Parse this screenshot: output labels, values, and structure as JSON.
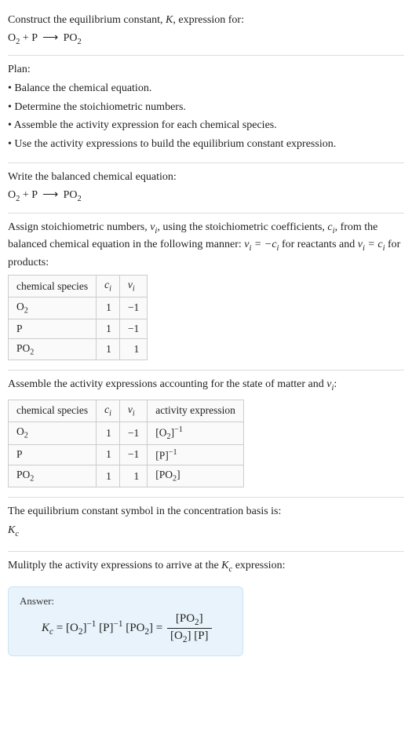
{
  "prompt": {
    "line1_a": "Construct the equilibrium constant, ",
    "line1_b": ", expression for:",
    "reaction_lhs_o2": "O",
    "reaction_plus": " + ",
    "reaction_lhs_p": "P",
    "reaction_arrow": "⟶",
    "reaction_rhs_po2": "PO"
  },
  "plan": {
    "heading": "Plan:",
    "b1": "• Balance the chemical equation.",
    "b2": "• Determine the stoichiometric numbers.",
    "b3": "• Assemble the activity expression for each chemical species.",
    "b4": "• Use the activity expressions to build the equilibrium constant expression."
  },
  "balanced": {
    "intro": "Write the balanced chemical equation:"
  },
  "assign": {
    "p_a": "Assign stoichiometric numbers, ",
    "p_b": ", using the stoichiometric coefficients, ",
    "p_c": ", from the balanced chemical equation in the following manner: ",
    "p_d": " for reactants and ",
    "p_e": " for products:",
    "nu": "ν",
    "ci": "c",
    "eq1_a": "ν",
    "eq1_b": " = −c",
    "eq2_a": "ν",
    "eq2_b": " = c",
    "sub_i": "i"
  },
  "table1": {
    "h1": "chemical species",
    "h2": "c",
    "h3": "ν",
    "rows": [
      {
        "sp_a": "O",
        "sp_sub": "2",
        "sp_b": "",
        "c": "1",
        "v": "−1"
      },
      {
        "sp_a": "P",
        "sp_sub": "",
        "sp_b": "",
        "c": "1",
        "v": "−1"
      },
      {
        "sp_a": "PO",
        "sp_sub": "2",
        "sp_b": "",
        "c": "1",
        "v": "1"
      }
    ]
  },
  "assemble": {
    "intro_a": "Assemble the activity expressions accounting for the state of matter and ",
    "intro_b": ":"
  },
  "table2": {
    "h1": "chemical species",
    "h2": "c",
    "h3": "ν",
    "h4": "activity expression",
    "rows": [
      {
        "sp_a": "O",
        "sp_sub": "2",
        "c": "1",
        "v": "−1",
        "ae_a": "[O",
        "ae_sub": "2",
        "ae_b": "]",
        "ae_sup": "−1"
      },
      {
        "sp_a": "P",
        "sp_sub": "",
        "c": "1",
        "v": "−1",
        "ae_a": "[P",
        "ae_sub": "",
        "ae_b": "]",
        "ae_sup": "−1"
      },
      {
        "sp_a": "PO",
        "sp_sub": "2",
        "c": "1",
        "v": "1",
        "ae_a": "[PO",
        "ae_sub": "2",
        "ae_b": "]",
        "ae_sup": ""
      }
    ]
  },
  "symbol": {
    "line": "The equilibrium constant symbol in the concentration basis is:",
    "K": "K",
    "sub_c": "c"
  },
  "multiply": {
    "line_a": "Mulitply the activity expressions to arrive at the ",
    "line_b": " expression:"
  },
  "answer": {
    "label": "Answer:",
    "K": "K",
    "sub_c": "c",
    "eq": " = ",
    "t1_a": "[O",
    "t1_sub": "2",
    "t1_b": "]",
    "t1_sup": "−1",
    "sp1": " ",
    "t2_a": "[P]",
    "t2_sup": "−1",
    "sp2": " ",
    "t3_a": "[PO",
    "t3_sub": "2",
    "t3_b": "]",
    "eq2": " = ",
    "frac_num_a": "[PO",
    "frac_num_sub": "2",
    "frac_num_b": "]",
    "frac_den_a": "[O",
    "frac_den_sub": "2",
    "frac_den_b": "] [P]"
  },
  "chart_data": {
    "type": "table",
    "tables": [
      {
        "title": "stoichiometric numbers",
        "columns": [
          "chemical species",
          "c_i",
          "ν_i"
        ],
        "rows": [
          [
            "O2",
            1,
            -1
          ],
          [
            "P",
            1,
            -1
          ],
          [
            "PO2",
            1,
            1
          ]
        ]
      },
      {
        "title": "activity expressions",
        "columns": [
          "chemical species",
          "c_i",
          "ν_i",
          "activity expression"
        ],
        "rows": [
          [
            "O2",
            1,
            -1,
            "[O2]^-1"
          ],
          [
            "P",
            1,
            -1,
            "[P]^-1"
          ],
          [
            "PO2",
            1,
            1,
            "[PO2]"
          ]
        ]
      }
    ]
  }
}
